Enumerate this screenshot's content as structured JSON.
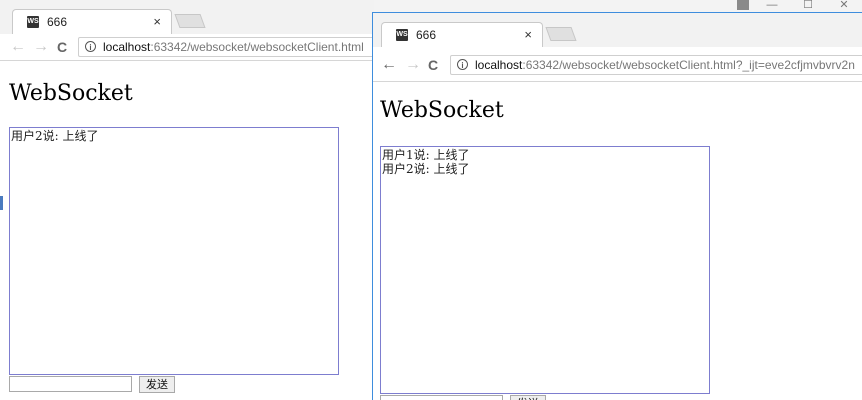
{
  "windows": [
    {
      "tab": {
        "favicon": "WS",
        "title": "666",
        "close": "×"
      },
      "nav": {
        "back": "←",
        "forward": "→",
        "reload": "C"
      },
      "address": {
        "host": "localhost",
        "rest": ":63342/websocket/websocketClient.html"
      },
      "page": {
        "heading": "WebSocket",
        "messages": [
          "用户2说: 上线了"
        ],
        "input_value": "",
        "send_label": "发送"
      }
    },
    {
      "tab": {
        "favicon": "WS",
        "title": "666",
        "close": "×"
      },
      "nav": {
        "back": "←",
        "forward": "→",
        "reload": "C"
      },
      "address": {
        "host": "localhost",
        "rest": ":63342/websocket/websocketClient.html?_ijt=eve2cfjmvbvrv2n"
      },
      "page": {
        "heading": "WebSocket",
        "messages": [
          "用户1说: 上线了",
          "用户2说: 上线了"
        ],
        "input_value": "",
        "send_label": "发送"
      }
    }
  ],
  "window_controls": {
    "minimize": "—",
    "maximize": "☐",
    "close": "✕"
  },
  "icons": {
    "favicon": "webstorm-icon",
    "info": "info-icon",
    "user": "user-icon"
  }
}
